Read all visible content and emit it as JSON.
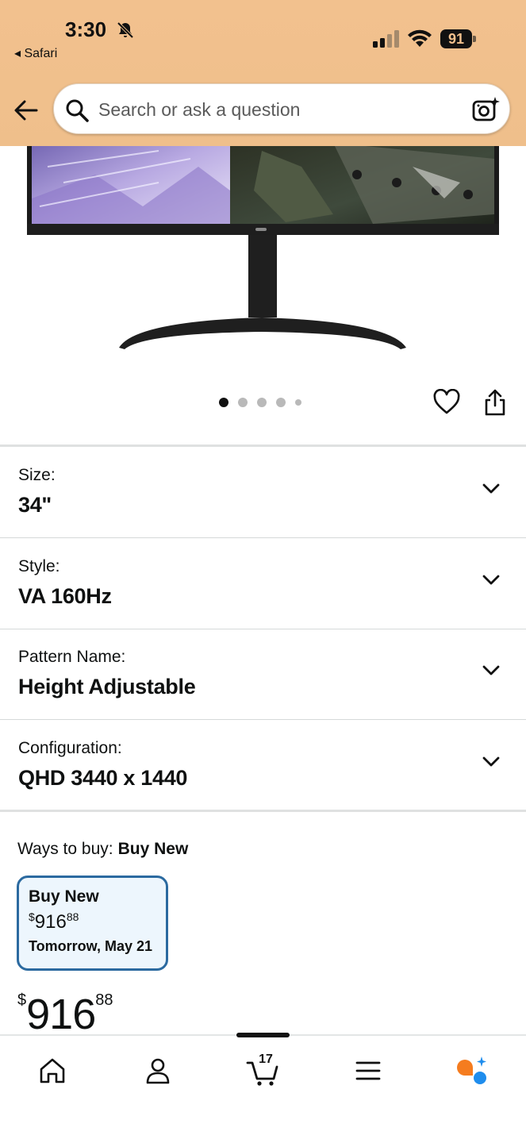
{
  "status_bar": {
    "time": "3:30",
    "back_app": "◂ Safari",
    "battery": "91"
  },
  "search": {
    "placeholder": "Search or ask a question"
  },
  "carousel": {
    "total": 5,
    "active_index": 0
  },
  "variations": [
    {
      "label": "Size:",
      "value": "34\""
    },
    {
      "label": "Style:",
      "value": "VA 160Hz"
    },
    {
      "label": "Pattern Name:",
      "value": "Height Adjustable"
    },
    {
      "label": "Configuration:",
      "value": "QHD 3440 x 1440"
    }
  ],
  "ways_to_buy": {
    "label": "Ways to buy:",
    "selected": "Buy New",
    "card": {
      "title": "Buy New",
      "price_symbol": "$",
      "price_whole": "916",
      "price_fraction": "88",
      "delivery": "Tomorrow, May 21"
    }
  },
  "price": {
    "symbol": "$",
    "whole": "916",
    "fraction": "88"
  },
  "bottom_nav": {
    "cart_count": "17",
    "items": [
      "home-icon",
      "account-icon",
      "cart-icon",
      "menu-icon",
      "rufus-icon"
    ]
  },
  "colors": {
    "header_bg": "#efbf8b",
    "selected_border": "#2b6aa0",
    "selected_bg": "#edf6fd",
    "rufus_orange": "#f57c1f",
    "rufus_blue": "#1f8ded"
  }
}
